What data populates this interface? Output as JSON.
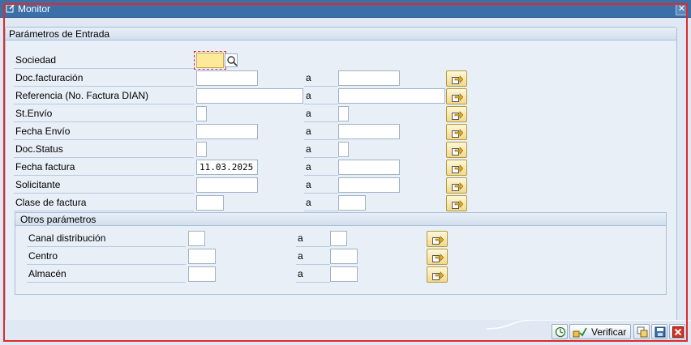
{
  "window": {
    "title": "Monitor",
    "close_glyph": "✕"
  },
  "main_group": {
    "title": "Parámetros de Entrada",
    "to_label": "a",
    "fields": [
      {
        "label": "Sociedad",
        "low": "",
        "high": null
      },
      {
        "label": "Doc.facturación",
        "low": "",
        "high": ""
      },
      {
        "label": "Referencia (No. Factura DIAN)",
        "low": "",
        "high": ""
      },
      {
        "label": "St.Envío",
        "low": "",
        "high": ""
      },
      {
        "label": "Fecha Envío",
        "low": "",
        "high": ""
      },
      {
        "label": "Doc.Status",
        "low": "",
        "high": ""
      },
      {
        "label": "Fecha factura",
        "low": "11.03.2025",
        "high": ""
      },
      {
        "label": "Solicitante",
        "low": "",
        "high": ""
      },
      {
        "label": "Clase de factura",
        "low": "",
        "high": ""
      }
    ]
  },
  "other_group": {
    "title": "Otros parámetros",
    "fields": [
      {
        "label": "Canal distribución",
        "low": "",
        "high": ""
      },
      {
        "label": "Centro",
        "low": "",
        "high": ""
      },
      {
        "label": "Almacén",
        "low": "",
        "high": ""
      }
    ]
  },
  "footer": {
    "verify_label": "Verificar"
  },
  "colors": {
    "title_bar": "#3b6fa8",
    "accent_red": "#e02a2a",
    "selection_button": "#f2d98a"
  },
  "icons": [
    "edit-icon",
    "search-icon",
    "multiple-selection-icon",
    "execute-clock-icon",
    "verify-icon",
    "copy-icon",
    "save-icon",
    "cancel-icon"
  ]
}
